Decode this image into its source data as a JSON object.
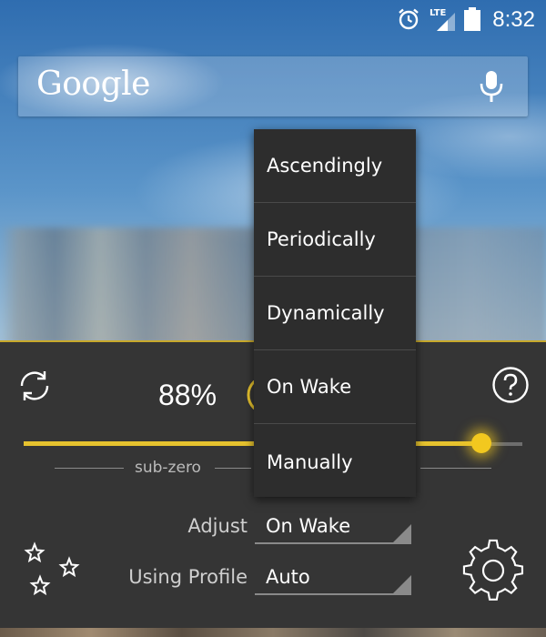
{
  "status_bar": {
    "time": "8:32",
    "network": "LTE",
    "icons": [
      "alarm-icon",
      "lte-signal-icon",
      "battery-icon"
    ]
  },
  "search": {
    "logo_text": "Google",
    "icons": [
      "mic-icon"
    ]
  },
  "panel": {
    "brightness_percent": "88%",
    "brightness_level": 0.88,
    "slider_label": "sub-zero",
    "adjust_label": "Adjust",
    "adjust_value": "On Wake",
    "profile_label": "Using Profile",
    "profile_value": "Auto",
    "icons": [
      "refresh-icon",
      "help-icon",
      "power-icon",
      "stars-icon",
      "gear-icon"
    ],
    "accent_color": "#e6c22e"
  },
  "menu": {
    "items": [
      "Ascendingly",
      "Periodically",
      "Dynamically",
      "On Wake",
      "Manually"
    ]
  }
}
